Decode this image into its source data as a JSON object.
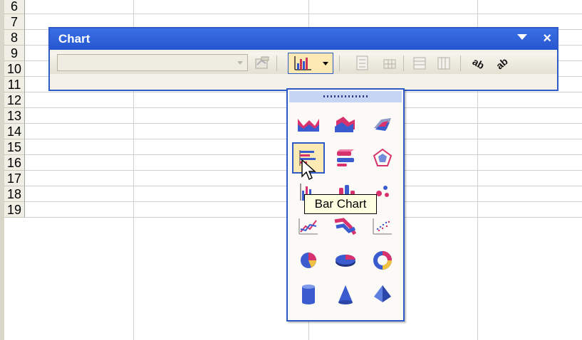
{
  "sheet": {
    "rows": [
      "6",
      "7",
      "8",
      "9",
      "10",
      "11",
      "12",
      "13",
      "14",
      "15",
      "16",
      "17",
      "18",
      "19"
    ]
  },
  "toolbar": {
    "title": "Chart",
    "close_glyph": "×",
    "chart_objects_value": "",
    "buttons": [
      {
        "name": "format-chart-area",
        "icon": "format-icon"
      },
      {
        "name": "chart-type",
        "icon": "bar-chart-icon"
      },
      {
        "name": "legend",
        "icon": "legend-icon"
      },
      {
        "name": "data-table",
        "icon": "data-table-icon"
      },
      {
        "name": "by-row",
        "icon": "by-row-icon"
      },
      {
        "name": "by-column",
        "icon": "by-column-icon"
      },
      {
        "name": "angle-text-downward",
        "icon": "angle-text-down-icon"
      },
      {
        "name": "angle-text-upward",
        "icon": "angle-text-up-icon"
      }
    ]
  },
  "palette": {
    "items": [
      {
        "name": "area-chart",
        "icon": "area-chart-icon"
      },
      {
        "name": "3d-area-chart",
        "icon": "3d-area-chart-icon"
      },
      {
        "name": "3d-surface-chart",
        "icon": "3d-surface-chart-icon"
      },
      {
        "name": "bar-chart",
        "icon": "bar-chart-icon",
        "selected": true
      },
      {
        "name": "3d-bar-chart",
        "icon": "3d-bar-chart-icon"
      },
      {
        "name": "radar-chart",
        "icon": "radar-chart-icon"
      },
      {
        "name": "column-chart",
        "icon": "column-chart-icon"
      },
      {
        "name": "3d-column-chart",
        "icon": "3d-column-chart-icon"
      },
      {
        "name": "bubble-chart",
        "icon": "bubble-chart-icon"
      },
      {
        "name": "line-chart",
        "icon": "line-chart-icon"
      },
      {
        "name": "3d-line-chart",
        "icon": "3d-line-chart-icon"
      },
      {
        "name": "scatter-chart",
        "icon": "scatter-chart-icon"
      },
      {
        "name": "pie-chart",
        "icon": "pie-chart-icon"
      },
      {
        "name": "3d-pie-chart",
        "icon": "3d-pie-chart-icon"
      },
      {
        "name": "doughnut-chart",
        "icon": "doughnut-chart-icon"
      },
      {
        "name": "cylinder-chart",
        "icon": "cylinder-chart-icon"
      },
      {
        "name": "cone-chart",
        "icon": "cone-chart-icon"
      },
      {
        "name": "pyramid-chart",
        "icon": "pyramid-chart-icon"
      }
    ]
  },
  "tooltip": {
    "text": "Bar Chart"
  },
  "colors": {
    "title_bar": "#2555cf",
    "frame": "#2e5ac7",
    "highlight": "#fce9b3",
    "tooltip_bg": "#ffffe1"
  }
}
